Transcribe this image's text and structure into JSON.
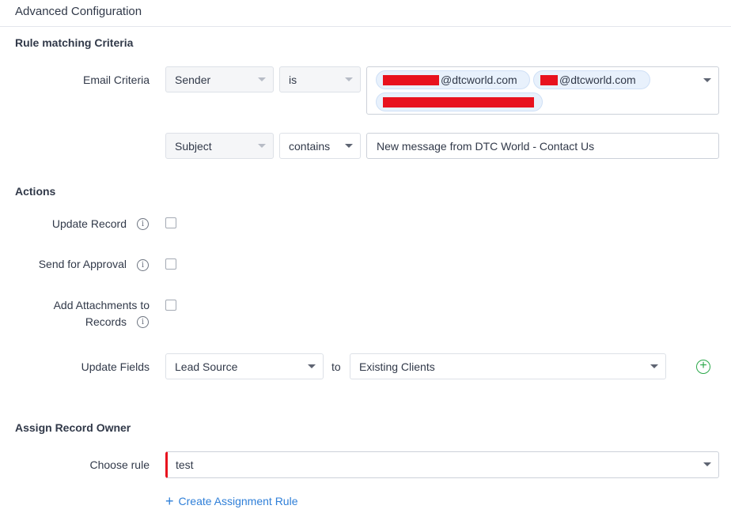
{
  "header": {
    "title": "Advanced Configuration"
  },
  "rule_matching": {
    "title": "Rule matching Criteria",
    "email_criteria": {
      "label": "Email Criteria",
      "field": "Sender",
      "operator": "is",
      "values": [
        "@dtcworld.com",
        "@dtcworld.com"
      ]
    },
    "subject_criteria": {
      "field": "Subject",
      "operator": "contains",
      "value": "New message from DTC World - Contact Us"
    }
  },
  "actions": {
    "title": "Actions",
    "update_record": {
      "label": "Update Record",
      "checked": false
    },
    "send_for_approval": {
      "label": "Send for Approval",
      "checked": false
    },
    "add_attachments": {
      "label_line1": "Add Attachments to",
      "label_line2": "Records",
      "checked": false
    },
    "update_fields": {
      "label": "Update Fields",
      "field": "Lead Source",
      "to_label": "to",
      "value": "Existing Clients"
    }
  },
  "assign_owner": {
    "title": "Assign Record Owner",
    "choose_rule_label": "Choose rule",
    "rule_value": "test",
    "create_link": "Create Assignment Rule"
  },
  "colors": {
    "accent_link": "#2f7fd8",
    "add_green": "#2ba84a",
    "redaction": "#e8121e",
    "required_marker": "#e8121e"
  }
}
